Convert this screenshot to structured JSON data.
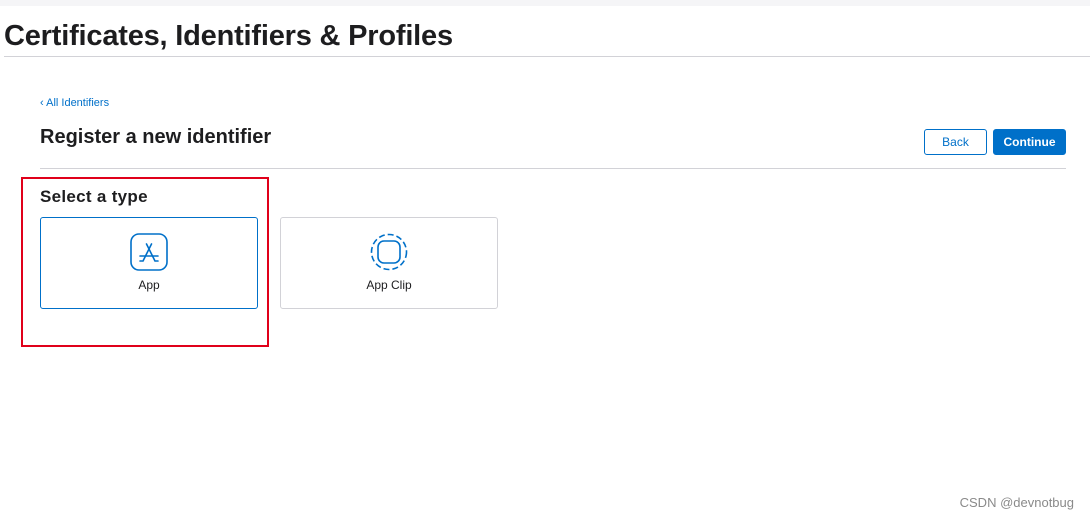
{
  "header": {
    "title": "Certificates, Identifiers & Profiles"
  },
  "nav": {
    "back_link": "‹ All Identifiers"
  },
  "section": {
    "title": "Register a new identifier",
    "back_button": "Back",
    "continue_button": "Continue"
  },
  "type_selector": {
    "heading": "Select a type",
    "options": [
      {
        "label": "App",
        "icon": "app-store-icon",
        "selected": true
      },
      {
        "label": "App Clip",
        "icon": "app-clip-icon",
        "selected": false
      }
    ]
  },
  "annotation": {
    "highlight_color": "#e0001a"
  },
  "watermark": {
    "text": "CSDN @devnotbug"
  },
  "colors": {
    "accent": "#0070c9",
    "text": "#1d1d1f",
    "divider": "#d2d2d7"
  }
}
